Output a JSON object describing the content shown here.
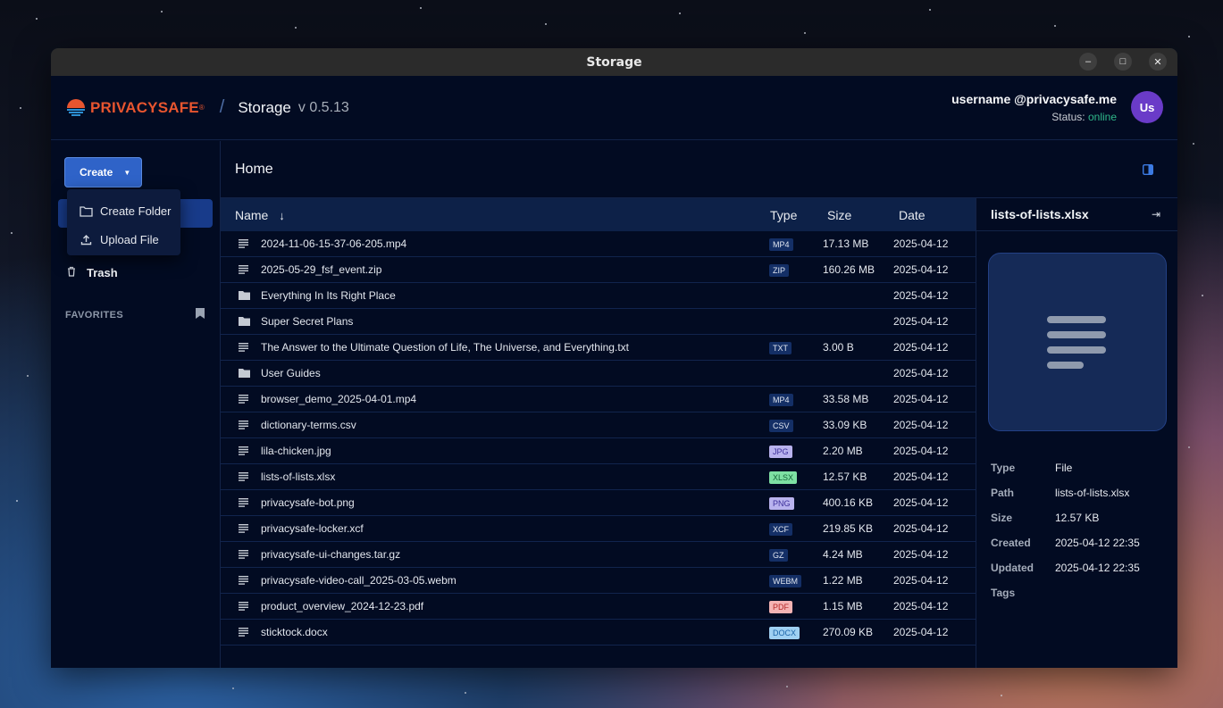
{
  "window": {
    "title": "Storage"
  },
  "header": {
    "brand": "PRIVACYSAFE",
    "brand_reg": "®",
    "separator": "/",
    "app_name": "Storage",
    "version": "v 0.5.13",
    "user_name": "username @privacysafe.me",
    "status_label": "Status:",
    "status_value": "online",
    "avatar_initials": "Us"
  },
  "sidebar": {
    "create_label": "Create",
    "menu": [
      {
        "label": "Create Folder",
        "icon": "folder-outline-icon"
      },
      {
        "label": "Upload File",
        "icon": "upload-icon"
      }
    ],
    "trash_label": "Trash",
    "favorites_label": "FAVORITES"
  },
  "content": {
    "breadcrumb": "Home",
    "columns": {
      "name": "Name",
      "type": "Type",
      "size": "Size",
      "date": "Date"
    },
    "files": [
      {
        "name": "2024-11-06-15-37-06-205.mp4",
        "kind": "file",
        "type": "MP4",
        "size": "17.13 MB",
        "date": "2025-04-12"
      },
      {
        "name": "2025-05-29_fsf_event.zip",
        "kind": "file",
        "type": "ZIP",
        "size": "160.26 MB",
        "date": "2025-04-12"
      },
      {
        "name": "Everything In Its Right Place",
        "kind": "folder",
        "type": "",
        "size": "",
        "date": "2025-04-12"
      },
      {
        "name": "Super Secret Plans",
        "kind": "folder",
        "type": "",
        "size": "",
        "date": "2025-04-12"
      },
      {
        "name": "The Answer to the Ultimate Question of Life, The Universe, and Everything.txt",
        "kind": "file",
        "type": "TXT",
        "size": "3.00 B",
        "date": "2025-04-12"
      },
      {
        "name": "User Guides",
        "kind": "folder",
        "type": "",
        "size": "",
        "date": "2025-04-12"
      },
      {
        "name": "browser_demo_2025-04-01.mp4",
        "kind": "file",
        "type": "MP4",
        "size": "33.58 MB",
        "date": "2025-04-12"
      },
      {
        "name": "dictionary-terms.csv",
        "kind": "file",
        "type": "CSV",
        "size": "33.09 KB",
        "date": "2025-04-12"
      },
      {
        "name": "lila-chicken.jpg",
        "kind": "file",
        "type": "JPG",
        "size": "2.20 MB",
        "date": "2025-04-12"
      },
      {
        "name": "lists-of-lists.xlsx",
        "kind": "file",
        "type": "XLSX",
        "size": "12.57 KB",
        "date": "2025-04-12"
      },
      {
        "name": "privacysafe-bot.png",
        "kind": "file",
        "type": "PNG",
        "size": "400.16 KB",
        "date": "2025-04-12"
      },
      {
        "name": "privacysafe-locker.xcf",
        "kind": "file",
        "type": "XCF",
        "size": "219.85 KB",
        "date": "2025-04-12"
      },
      {
        "name": "privacysafe-ui-changes.tar.gz",
        "kind": "file",
        "type": "GZ",
        "size": "4.24 MB",
        "date": "2025-04-12"
      },
      {
        "name": "privacysafe-video-call_2025-03-05.webm",
        "kind": "file",
        "type": "WEBM",
        "size": "1.22 MB",
        "date": "2025-04-12"
      },
      {
        "name": "product_overview_2024-12-23.pdf",
        "kind": "file",
        "type": "PDF",
        "size": "1.15 MB",
        "date": "2025-04-12"
      },
      {
        "name": "sticktock.docx",
        "kind": "file",
        "type": "DOCX",
        "size": "270.09 KB",
        "date": "2025-04-12"
      }
    ]
  },
  "details": {
    "title": "lists-of-lists.xlsx",
    "props": [
      {
        "key": "Type",
        "value": "File"
      },
      {
        "key": "Path",
        "value": "lists-of-lists.xlsx"
      },
      {
        "key": "Size",
        "value": "12.57 KB"
      },
      {
        "key": "Created",
        "value": "2025-04-12 22:35"
      },
      {
        "key": "Updated",
        "value": "2025-04-12 22:35"
      },
      {
        "key": "Tags",
        "value": ""
      }
    ]
  },
  "colors": {
    "accent": "#2f63c8",
    "brand": "#e8552f",
    "online": "#2fb88a",
    "avatar": "#6a3bc8"
  }
}
